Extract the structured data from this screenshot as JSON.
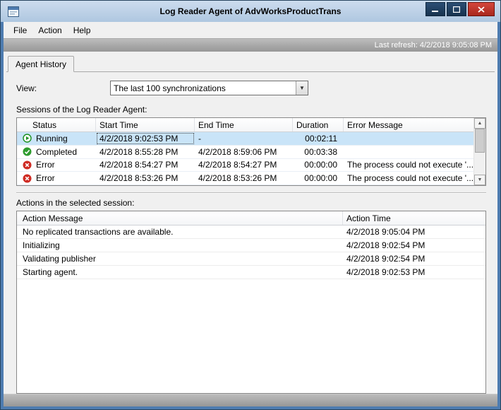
{
  "titlebar": {
    "title": "Log Reader Agent of AdvWorksProductTrans"
  },
  "menubar": {
    "items": [
      "File",
      "Action",
      "Help"
    ]
  },
  "refresh": {
    "text": "Last refresh: 4/2/2018 9:05:08 PM"
  },
  "tab": {
    "label": "Agent History"
  },
  "view": {
    "label": "View:",
    "selected": "The last 100 synchronizations"
  },
  "sessions": {
    "heading": "Sessions of the Log Reader Agent:",
    "columns": {
      "status": "Status",
      "start": "Start Time",
      "end": "End Time",
      "duration": "Duration",
      "error": "Error Message"
    },
    "rows": [
      {
        "icon": "running-icon",
        "status": "Running",
        "start": "4/2/2018 9:02:53 PM",
        "end": "-",
        "duration": "00:02:11",
        "error": "",
        "selected": true
      },
      {
        "icon": "completed-icon",
        "status": "Completed",
        "start": "4/2/2018 8:55:28 PM",
        "end": "4/2/2018 8:59:06 PM",
        "duration": "00:03:38",
        "error": "",
        "selected": false
      },
      {
        "icon": "error-icon",
        "status": "Error",
        "start": "4/2/2018 8:54:27 PM",
        "end": "4/2/2018 8:54:27 PM",
        "duration": "00:00:00",
        "error": "The process could not execute '...",
        "selected": false
      },
      {
        "icon": "error-icon",
        "status": "Error",
        "start": "4/2/2018 8:53:26 PM",
        "end": "4/2/2018 8:53:26 PM",
        "duration": "00:00:00",
        "error": "The process could not execute '...",
        "selected": false
      }
    ]
  },
  "actions": {
    "heading": "Actions in the selected session:",
    "columns": {
      "message": "Action Message",
      "time": "Action Time"
    },
    "rows": [
      {
        "message": "No replicated transactions are available.",
        "time": "4/2/2018 9:05:04 PM"
      },
      {
        "message": "Initializing",
        "time": "4/2/2018 9:02:54 PM"
      },
      {
        "message": "Validating publisher",
        "time": "4/2/2018 9:02:54 PM"
      },
      {
        "message": "Starting agent.",
        "time": "4/2/2018 9:02:53 PM"
      }
    ]
  },
  "icons": {
    "running": "green-play-in-circle",
    "completed": "green-circle-white-check",
    "error": "red-circle-white-x",
    "dropdown_arrow": "▼",
    "scroll_up": "▲",
    "scroll_down": "▼"
  },
  "colors": {
    "window_frame": "#4e7cb0",
    "titlebar_bg": "#bdd1e7",
    "close_button": "#b5352a",
    "selected_row": "#c9e4f8",
    "running_green": "#1a8f1f",
    "completed_green": "#2e9b2e",
    "error_red": "#cf2b23",
    "gray_bar": "#a7a7a7"
  }
}
